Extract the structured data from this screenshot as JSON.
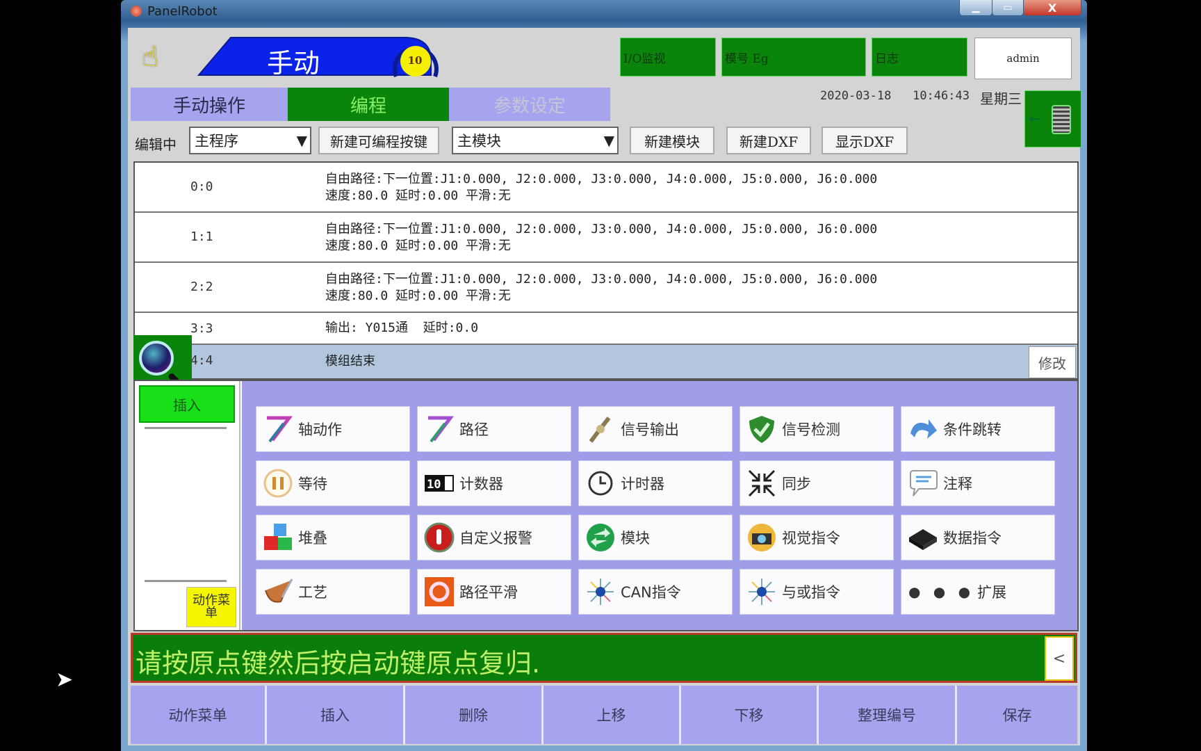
{
  "window": {
    "title": "PanelRobot",
    "minimize": "▁",
    "maximize": "▭",
    "close": "X"
  },
  "header": {
    "hand_icon": "pointing-hand-icon",
    "mode": "手动",
    "speed": "10",
    "speed_unit": "%",
    "io_monitor": "I/O监视",
    "tag": "模号 Eg",
    "log": "日志",
    "user": "admin",
    "date": "2020-03-18",
    "time": "10:46:43",
    "weekday": "星期三"
  },
  "tabs": [
    {
      "label": "手动操作",
      "state": "normal"
    },
    {
      "label": "编程",
      "state": "active"
    },
    {
      "label": "参数设定",
      "state": "disabled"
    }
  ],
  "edit_toolbar": {
    "editing_label": "编辑中",
    "program_select": "主程序",
    "new_key_button": "新建可编程按键",
    "module_select": "主模块",
    "new_module_button": "新建模块",
    "new_dxf_button": "新建DXF",
    "show_dxf_button": "显示DXF"
  },
  "program": {
    "rows": [
      {
        "num": "0:0",
        "line1": "自由路径:下一位置:J1:0.000, J2:0.000, J3:0.000, J4:0.000, J5:0.000, J6:0.000",
        "line2": "速度:80.0 延时:0.00 平滑:无"
      },
      {
        "num": "1:1",
        "line1": "自由路径:下一位置:J1:0.000, J2:0.000, J3:0.000, J4:0.000, J5:0.000, J6:0.000",
        "line2": "速度:80.0 延时:0.00 平滑:无"
      },
      {
        "num": "2:2",
        "line1": "自由路径:下一位置:J1:0.000, J2:0.000, J3:0.000, J4:0.000, J5:0.000, J6:0.000",
        "line2": "速度:80.0 延时:0.00 平滑:无"
      },
      {
        "num": "3:3",
        "line1": "输出: Y015通  延时:0.0",
        "line2": ""
      },
      {
        "num": "4:4",
        "line1": "模组结束",
        "line2": "",
        "selected": true
      }
    ],
    "modify_button": "修改"
  },
  "action_panel": {
    "insert_button": "插入",
    "action_menu_button": "动作菜单",
    "commands": [
      {
        "label": "轴动作",
        "icon": "axis-motion-icon"
      },
      {
        "label": "路径",
        "icon": "path-icon"
      },
      {
        "label": "信号输出",
        "icon": "signal-output-icon"
      },
      {
        "label": "信号检测",
        "icon": "signal-check-shield-icon"
      },
      {
        "label": "条件跳转",
        "icon": "conditional-jump-arrow-icon"
      },
      {
        "label": "等待",
        "icon": "pause-icon"
      },
      {
        "label": "计数器",
        "icon": "counter-icon"
      },
      {
        "label": "计时器",
        "icon": "timer-watch-icon"
      },
      {
        "label": "同步",
        "icon": "sync-arrows-icon"
      },
      {
        "label": "注释",
        "icon": "comment-bubble-icon"
      },
      {
        "label": "堆叠",
        "icon": "stack-cubes-icon"
      },
      {
        "label": "自定义报警",
        "icon": "custom-alarm-icon"
      },
      {
        "label": "模块",
        "icon": "module-swap-icon"
      },
      {
        "label": "视觉指令",
        "icon": "vision-camera-icon"
      },
      {
        "label": "数据指令",
        "icon": "data-box-icon"
      },
      {
        "label": "工艺",
        "icon": "craft-brush-icon"
      },
      {
        "label": "路径平滑",
        "icon": "path-smooth-icon"
      },
      {
        "label": "CAN指令",
        "icon": "can-network-icon"
      },
      {
        "label": "与或指令",
        "icon": "logic-network-icon"
      },
      {
        "label": "扩展",
        "icon": "extend-dots-icon",
        "prefix": "● ● ●"
      }
    ]
  },
  "status": {
    "message": "请按原点键然后按启动键原点复归.",
    "collapse": "<"
  },
  "bottom_bar": [
    "动作菜单",
    "插入",
    "删除",
    "上移",
    "下移",
    "整理编号",
    "保存"
  ],
  "colors": {
    "green": "#0a840a",
    "lavender": "#a6a4ee",
    "mode_blue": "#0b22e8",
    "status_text": "#bff06a"
  }
}
